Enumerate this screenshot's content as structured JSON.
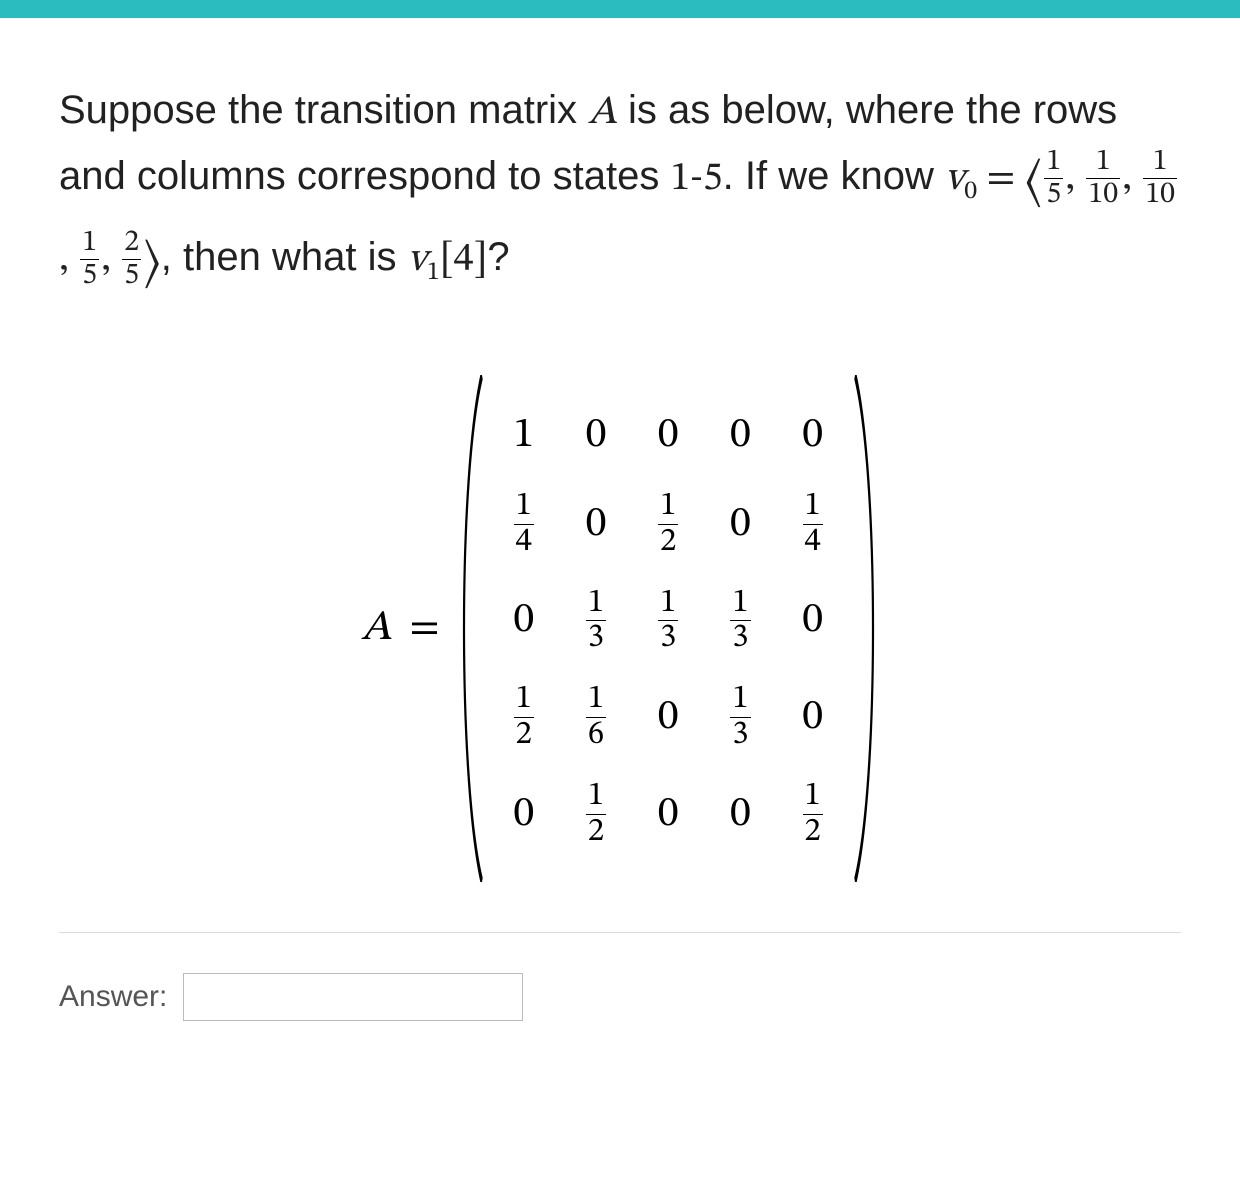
{
  "question": {
    "pre_text": "Suppose the transition matrix ",
    "matrix_symbol": "A",
    "mid_text_1": " is as below, where the rows and columns correspond to states ",
    "states_range": "1-5",
    "mid_text_2": ". If we know ",
    "v0_symbol": "v",
    "v0_sub": "0",
    "equals": " = ",
    "vector_open": "⟨",
    "vector_close": "⟩",
    "post_vector": ", then what is ",
    "v1_symbol": "v",
    "v1_sub": "1",
    "v1_index": "[4]",
    "qmark": "?",
    "v0": [
      {
        "num": "1",
        "den": "5"
      },
      {
        "num": "1",
        "den": "10"
      },
      {
        "num": "1",
        "den": "10"
      },
      {
        "num": "1",
        "den": "5"
      },
      {
        "num": "2",
        "den": "5"
      }
    ]
  },
  "matrix": {
    "lhs": "A",
    "eq": "=",
    "rows": [
      [
        {
          "v": "1"
        },
        {
          "v": "0"
        },
        {
          "v": "0"
        },
        {
          "v": "0"
        },
        {
          "v": "0"
        }
      ],
      [
        {
          "n": "1",
          "d": "4"
        },
        {
          "v": "0"
        },
        {
          "n": "1",
          "d": "2"
        },
        {
          "v": "0"
        },
        {
          "n": "1",
          "d": "4"
        }
      ],
      [
        {
          "v": "0"
        },
        {
          "n": "1",
          "d": "3"
        },
        {
          "n": "1",
          "d": "3"
        },
        {
          "n": "1",
          "d": "3"
        },
        {
          "v": "0"
        }
      ],
      [
        {
          "n": "1",
          "d": "2"
        },
        {
          "n": "1",
          "d": "6"
        },
        {
          "v": "0"
        },
        {
          "n": "1",
          "d": "3"
        },
        {
          "v": "0"
        }
      ],
      [
        {
          "v": "0"
        },
        {
          "n": "1",
          "d": "2"
        },
        {
          "v": "0"
        },
        {
          "v": "0"
        },
        {
          "n": "1",
          "d": "2"
        }
      ]
    ]
  },
  "answer": {
    "label": "Answer:",
    "value": ""
  }
}
